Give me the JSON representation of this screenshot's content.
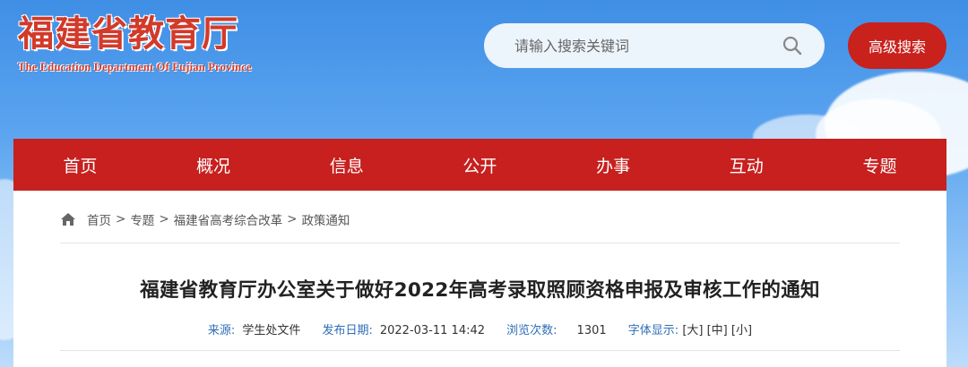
{
  "header": {
    "logo_title": "福建省教育厅",
    "logo_subtitle": "The Education Department Of Fujian Province",
    "search_placeholder": "请输入搜索关键词",
    "advanced_search_label": "高级搜索"
  },
  "nav": {
    "items": [
      "首页",
      "概况",
      "信息",
      "公开",
      "办事",
      "互动",
      "专题"
    ]
  },
  "breadcrumb": {
    "items": [
      "首页",
      "专题",
      "福建省高考综合改革",
      "政策通知"
    ],
    "separator": ">"
  },
  "article": {
    "title": "福建省教育厅办公室关于做好2022年高考录取照顾资格申报及审核工作的通知",
    "source_label": "来源:",
    "source_value": "学生处文件",
    "date_label": "发布日期:",
    "date_value": "2022-03-11 14:42",
    "views_label": "浏览次数:",
    "views_value": "1301",
    "fontsize_label": "字体显示:",
    "fontsize_large": "[大]",
    "fontsize_medium": "[中]",
    "fontsize_small": "[小]"
  },
  "colors": {
    "brand_red": "#c7201e",
    "sky_blue": "#5aa3ef",
    "meta_label_blue": "#2e6eb7"
  },
  "icons": [
    "search-icon",
    "home-icon"
  ]
}
